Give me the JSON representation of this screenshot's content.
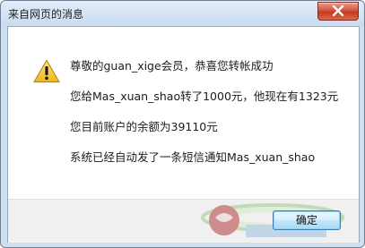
{
  "window": {
    "title": "来自网页的消息"
  },
  "message": {
    "line1": "尊敬的guan_xige会员，恭喜您转帐成功",
    "line2": "您给Mas_xuan_shao转了1000元，他现在有1323元",
    "line3": "您目前账户的余额为39110元",
    "line4": "系统已经自动发了一条短信通知Mas_xuan_shao"
  },
  "buttons": {
    "ok_label": "确定"
  },
  "icons": {
    "title_close": "close-icon",
    "message": "warning-icon",
    "watermark": "watermark-logo"
  },
  "colors": {
    "close_button": "#c9442c",
    "warning_yellow": "#f4c531",
    "ok_button_border": "#3c7fb1"
  }
}
